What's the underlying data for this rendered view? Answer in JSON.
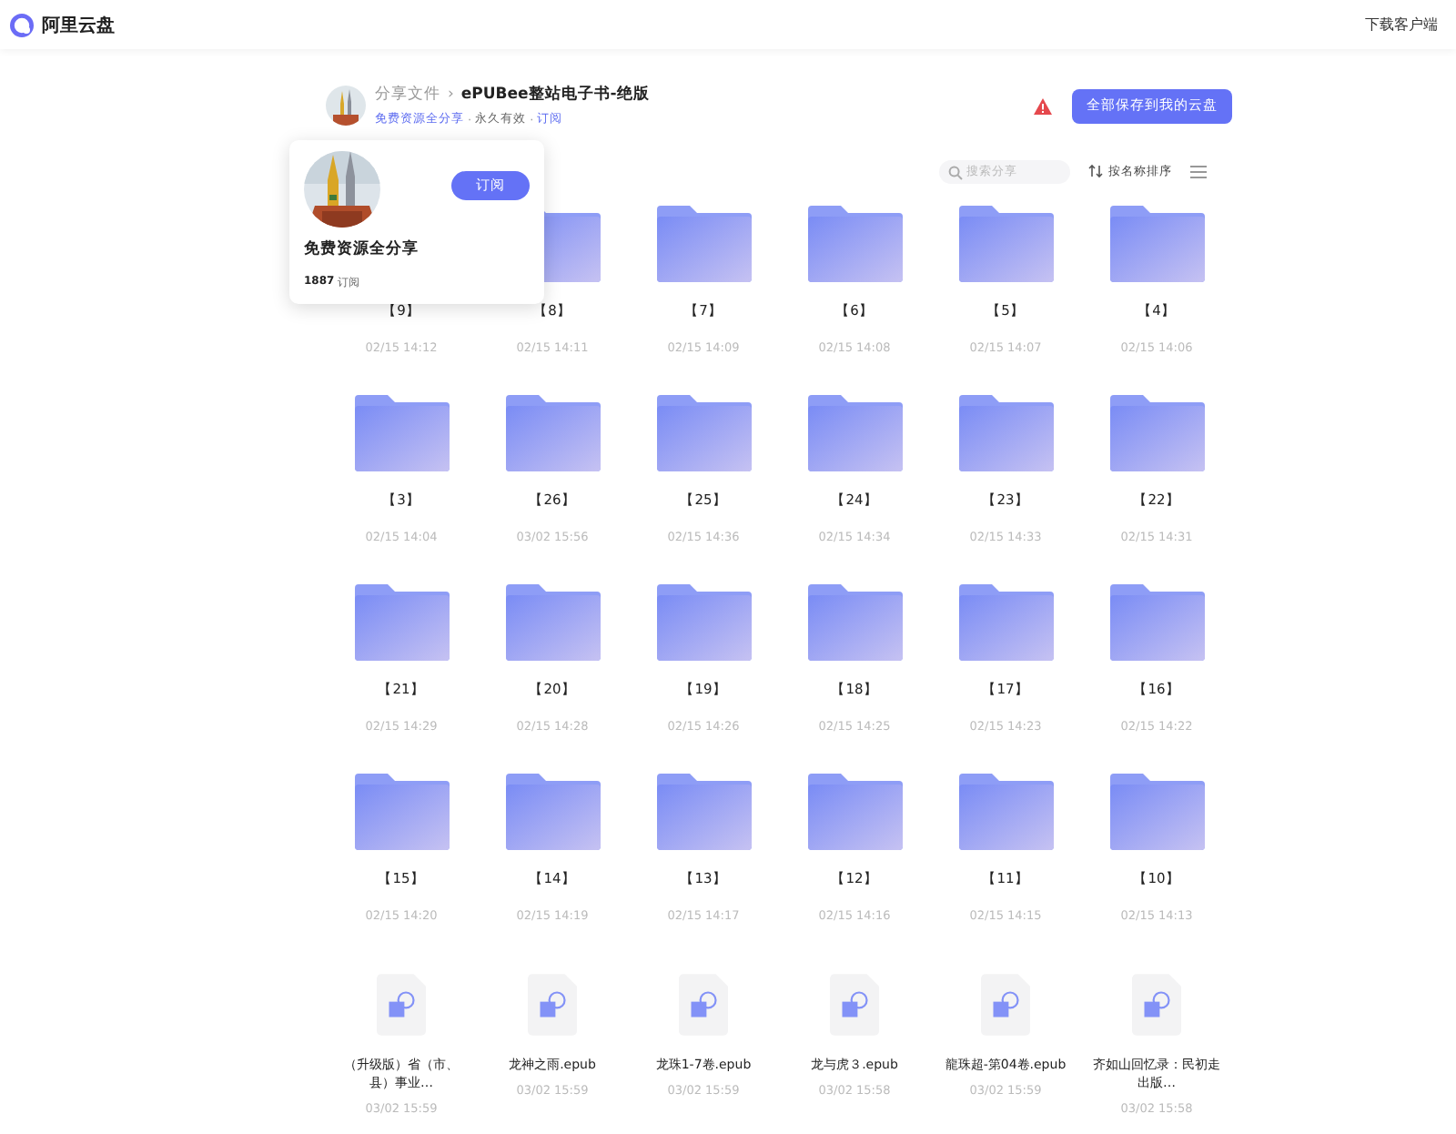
{
  "header": {
    "logo": "阿里云盘",
    "download": "下载客户端"
  },
  "share": {
    "root": "分享文件",
    "separator": "›",
    "title": "ePUBee整站电子书-绝版",
    "owner": "免费资源全分享",
    "dot_1": "·",
    "validity": "永久有效",
    "dot_2": "·",
    "subscribe": "订阅"
  },
  "save_button": "全部保存到我的云盘",
  "toolbar": {
    "search": {
      "placeholder": "搜索分享"
    },
    "sort": "按名称排序"
  },
  "popup": {
    "name": "免费资源全分享",
    "subscribe_button": "订阅",
    "subscribers": "1887",
    "subscribers_label": "订阅"
  },
  "items": [
    {
      "kind": "folder",
      "name": "【9】",
      "date": "02/15 14:12",
      "icon_covered": true
    },
    {
      "kind": "folder",
      "name": "【8】",
      "date": "02/15 14:11"
    },
    {
      "kind": "folder",
      "name": "【7】",
      "date": "02/15 14:09"
    },
    {
      "kind": "folder",
      "name": "【6】",
      "date": "02/15 14:08"
    },
    {
      "kind": "folder",
      "name": "【5】",
      "date": "02/15 14:07"
    },
    {
      "kind": "folder",
      "name": "【4】",
      "date": "02/15 14:06"
    },
    {
      "kind": "folder",
      "name": "【3】",
      "date": "02/15 14:04"
    },
    {
      "kind": "folder",
      "name": "【26】",
      "date": "03/02 15:56"
    },
    {
      "kind": "folder",
      "name": "【25】",
      "date": "02/15 14:36"
    },
    {
      "kind": "folder",
      "name": "【24】",
      "date": "02/15 14:34"
    },
    {
      "kind": "folder",
      "name": "【23】",
      "date": "02/15 14:33"
    },
    {
      "kind": "folder",
      "name": "【22】",
      "date": "02/15 14:31"
    },
    {
      "kind": "folder",
      "name": "【21】",
      "date": "02/15 14:29"
    },
    {
      "kind": "folder",
      "name": "【20】",
      "date": "02/15 14:28"
    },
    {
      "kind": "folder",
      "name": "【19】",
      "date": "02/15 14:26"
    },
    {
      "kind": "folder",
      "name": "【18】",
      "date": "02/15 14:25"
    },
    {
      "kind": "folder",
      "name": "【17】",
      "date": "02/15 14:23"
    },
    {
      "kind": "folder",
      "name": "【16】",
      "date": "02/15 14:22"
    },
    {
      "kind": "folder",
      "name": "【15】",
      "date": "02/15 14:20"
    },
    {
      "kind": "folder",
      "name": "【14】",
      "date": "02/15 14:19"
    },
    {
      "kind": "folder",
      "name": "【13】",
      "date": "02/15 14:17"
    },
    {
      "kind": "folder",
      "name": "【12】",
      "date": "02/15 14:16"
    },
    {
      "kind": "folder",
      "name": "【11】",
      "date": "02/15 14:15"
    },
    {
      "kind": "folder",
      "name": "【10】",
      "date": "02/15 14:13"
    },
    {
      "kind": "file",
      "name": "（升级版）省（市、县）事业…",
      "date": "03/02 15:59"
    },
    {
      "kind": "file",
      "name": "龙神之雨.epub",
      "date": "03/02 15:59"
    },
    {
      "kind": "file",
      "name": "龙珠1-7卷.epub",
      "date": "03/02 15:59"
    },
    {
      "kind": "file",
      "name": "龙与虎３.epub",
      "date": "03/02 15:58"
    },
    {
      "kind": "file",
      "name": "龍珠超-第04卷.epub",
      "date": "03/02 15:59"
    },
    {
      "kind": "file",
      "name": "齐如山回忆录：民初走出版…",
      "date": "03/02 15:58"
    }
  ]
}
